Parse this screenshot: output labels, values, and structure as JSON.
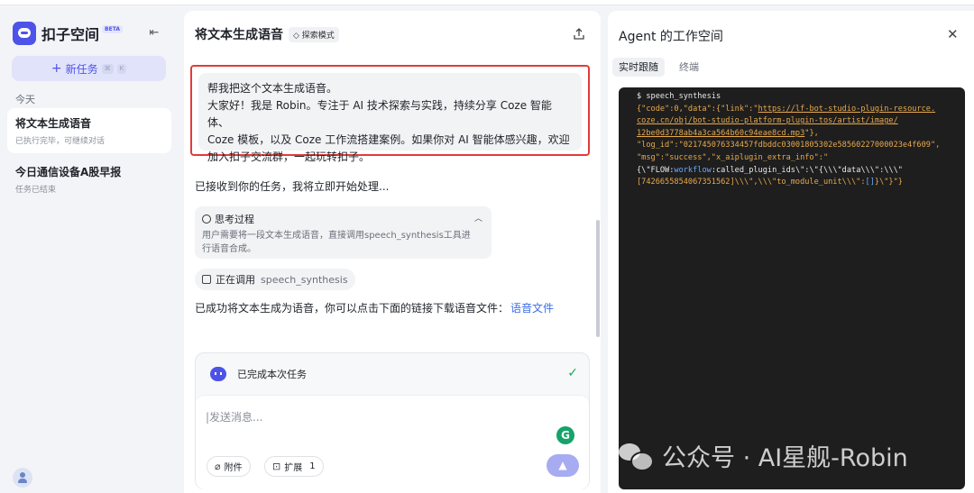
{
  "sidebar": {
    "brand_name": "扣子空间",
    "beta_label": "BETA",
    "new_task_label": "新任务",
    "new_task_shortcut_1": "⌘",
    "new_task_shortcut_2": "K",
    "section_today": "今天",
    "tasks": [
      {
        "title": "将文本生成语音",
        "subtitle": "已执行完毕，可继续对话"
      },
      {
        "title": "今日通信设备A股早报",
        "subtitle": "任务已结束"
      }
    ]
  },
  "chat": {
    "title": "将文本生成语音",
    "mode_tag": "探索模式",
    "user_message_lines": [
      "帮我把这个文本生成语音。",
      "大家好！我是 Robin。专注于 AI 技术探索与实践，持续分享 Coze 智能体、",
      "Coze 模板，以及 Coze 工作流搭建案例。如果你对 AI 智能体感兴趣，欢迎",
      "加入扣子交流群，一起玩转扣子。"
    ],
    "ack_text": "已接收到你的任务，我将立即开始处理...",
    "thinking": {
      "label": "思考过程",
      "body_line_1": "用户需要将一段文本生成语音，直接调用speech_synthesis工具进",
      "body_line_2": "行语音合成。"
    },
    "calling": {
      "label": "正在调用",
      "tool": "speech_synthesis"
    },
    "result_text": "已成功将文本生成为语音，你可以点击下面的链接下载语音文件：",
    "result_link": "语音文件",
    "status_text": "已完成本次任务",
    "input_placeholder": "发送消息...",
    "grammarly_letter": "G",
    "attach_label": "附件",
    "extend_label": "扩展",
    "extend_count": "1"
  },
  "agent": {
    "title": "Agent 的工作空间",
    "tabs": [
      {
        "label": "实时跟随",
        "active": true
      },
      {
        "label": "终端",
        "active": false
      }
    ],
    "terminal": {
      "command": "$ speech_synthesis",
      "l1a": "{\"code\":0,\"data\":{\"link\":\"",
      "l1b": "https://lf-bot-studio-plugin-resource.",
      "l2a": "coze.cn/obj/bot-studio-platform-plugin-tos/artist/image/",
      "l3a": "12be0d3778ab4a3ca564b60c94eae8cd.mp3",
      "l3b": "\"},",
      "l4": "\"log_id\":\"021745076334457fdbddc03001805302e58560227000023e4f609\",",
      "l5": "\"msg\":\"success\",\"x_aiplugin_extra_info\":\"",
      "l6a": "{\\\"FLOW:",
      "l6b": "workflow",
      "l6c": ":called_plugin_ids\\\":\\\"{\\\\\\\"data\\\\\\\":\\\\\\\"",
      "l7a": "[7426655854067351562]\\\\\\\",\\\\\\\"to_module_unit\\\\\\\":",
      "l7b": "[]",
      "l7c": "}\\\"}\"}"
    }
  },
  "watermark": {
    "text": "公众号 · AI星舰-Robin"
  },
  "colors": {
    "accent": "#4d53e8",
    "highlight_border": "#e23b3b",
    "link": "#3c6ee8",
    "success": "#22a35a",
    "terminal_bg": "#1e1e1e",
    "terminal_string": "#e8a94d"
  }
}
